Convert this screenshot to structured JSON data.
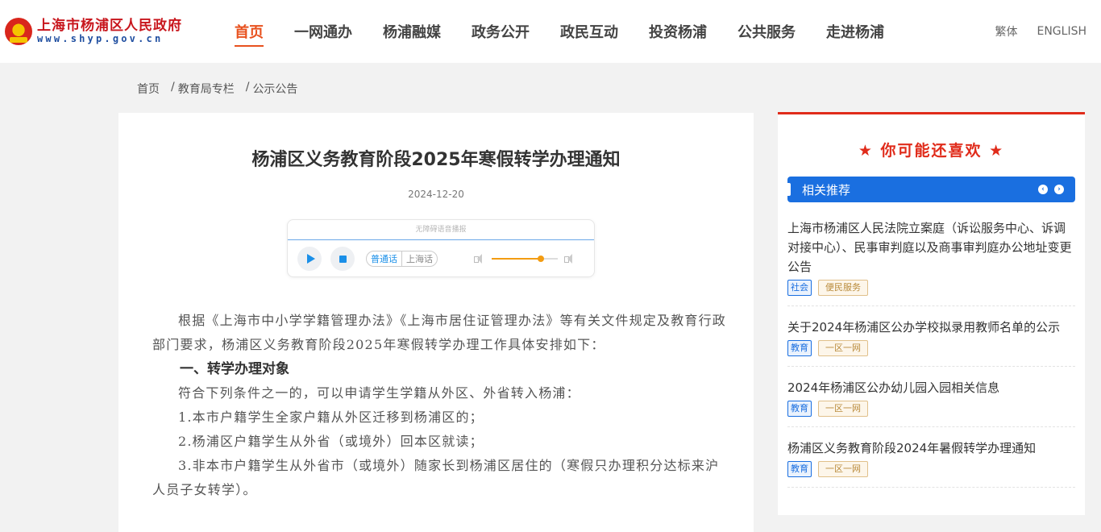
{
  "header": {
    "logo_cn": "上海市杨浦区人民政府",
    "logo_en": "www.shyp.gov.cn",
    "nav": [
      "首页",
      "一网通办",
      "杨浦融媒",
      "政务公开",
      "政民互动",
      "投资杨浦",
      "公共服务",
      "走进杨浦"
    ],
    "active_nav": "首页",
    "lang_traditional": "繁体",
    "lang_english": "ENGLISH"
  },
  "breadcrumb": [
    "首页",
    "教育局专栏",
    "公示公告"
  ],
  "article": {
    "title": "杨浦区义务教育阶段2025年寒假转学办理通知",
    "date": "2024-12-20",
    "player": {
      "label": "无障碍语音播报",
      "lang_mandarin": "普通话",
      "lang_shanghai": "上海话",
      "volume_level": 0.74
    },
    "paragraphs": [
      "根据《上海市中小学学籍管理办法》《上海市居住证管理办法》等有关文件规定及教育行政部门要求，杨浦区义务教育阶段2025年寒假转学办理工作具体安排如下：",
      "一、转学办理对象",
      "符合下列条件之一的，可以申请学生学籍从外区、外省转入杨浦：",
      "1.本市户籍学生全家户籍从外区迁移到杨浦区的；",
      "2.杨浦区户籍学生从外省（或境外）回本区就读；",
      "3.非本市户籍学生从外省市（或境外）随家长到杨浦区居住的（寒假只办理积分达标来沪人员子女转学）。"
    ]
  },
  "sidebar": {
    "heading": "★ 你可能还喜欢 ★",
    "tab_label": "相关推荐",
    "items": [
      {
        "title": "上海市杨浦区人民法院立案庭（诉讼服务中心、诉调对接中心）、民事审判庭以及商事审判庭办公地址变更公告",
        "tag1": "社会",
        "tag2": "便民服务"
      },
      {
        "title": "关于2024年杨浦区公办学校拟录用教师名单的公示",
        "tag1": "教育",
        "tag2": "一区一网"
      },
      {
        "title": "2024年杨浦区公办幼儿园入园相关信息",
        "tag1": "教育",
        "tag2": "一区一网"
      },
      {
        "title": "杨浦区义务教育阶段2024年暑假转学办理通知",
        "tag1": "教育",
        "tag2": "一区一网"
      }
    ]
  },
  "colors": {
    "accent_red": "#e02b1a",
    "nav_active": "#e8511e",
    "tab_blue": "#1a6fe0"
  }
}
